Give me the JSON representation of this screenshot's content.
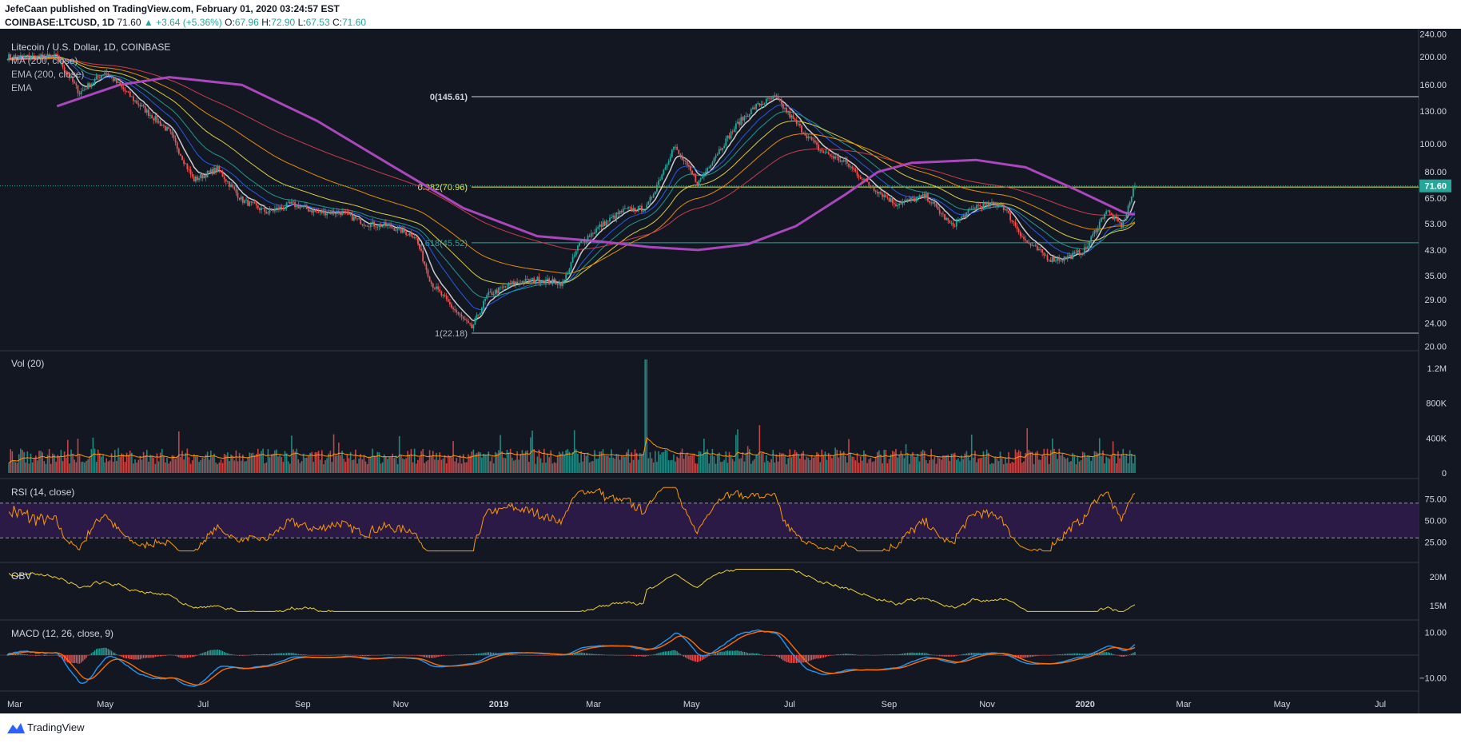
{
  "header": {
    "line1": "JefeCaan published on TradingView.com, February 01, 2020 03:24:57 EST",
    "symbol": "COINBASE:LTCUSD, 1D",
    "last": "71.60",
    "change": "+3.64 (+5.36%)",
    "o_label": "O:",
    "o": "67.96",
    "h_label": "H:",
    "h": "72.90",
    "l_label": "L:",
    "l": "67.53",
    "c_label": "C:",
    "c": "71.60"
  },
  "price_pane": {
    "title": "Litecoin / U.S. Dollar, 1D, COINBASE",
    "indicators": [
      "MA (200, close)",
      "EMA (200, close)",
      "EMA"
    ],
    "current_price_tag": "71.60"
  },
  "volume_pane": {
    "title": "Vol (20)"
  },
  "rsi_pane": {
    "title": "RSI (14, close)"
  },
  "obv_pane": {
    "title": "OBV"
  },
  "macd_pane": {
    "title": "MACD (12, 26, close, 9)"
  },
  "footer": {
    "brand": "TradingView",
    "logo_icon": "tradingview-logo-icon"
  },
  "colors": {
    "background": "#131722",
    "up": "#26a69a",
    "down": "#ef5350",
    "ma200": "#ab47bc",
    "fib_line": "#e0f040",
    "fib_618": "#26a69a",
    "rsi": "#ff9800",
    "obv": "#f0d030",
    "macd": "#2196f3",
    "signal": "#ff6d00"
  },
  "chart_data": [
    {
      "type": "line",
      "title": "Litecoin / U.S. Dollar, 1D, COINBASE",
      "scale": "log",
      "x_axis_labels": [
        "Mar",
        "May",
        "Jul",
        "Sep",
        "Nov",
        "2019",
        "Mar",
        "May",
        "Jul",
        "Sep",
        "Nov",
        "2020",
        "Mar",
        "May",
        "Jul"
      ],
      "y_axis_labels": [
        "240.00",
        "200.00",
        "160.00",
        "130.00",
        "100.00",
        "80.00",
        "65.00",
        "53.00",
        "43.00",
        "35.00",
        "29.00",
        "24.00",
        "20.00"
      ],
      "series": [
        {
          "name": "LTCUSD",
          "x": [
            "2018-04-01",
            "2018-04-15",
            "2018-05-01",
            "2018-05-20",
            "2018-06-10",
            "2018-06-25",
            "2018-07-10",
            "2018-07-25",
            "2018-08-10",
            "2018-08-25",
            "2018-09-10",
            "2018-09-25",
            "2018-10-10",
            "2018-10-25",
            "2018-11-10",
            "2018-11-20",
            "2018-12-01",
            "2018-12-15",
            "2018-12-25",
            "2019-01-10",
            "2019-01-25",
            "2019-02-10",
            "2019-02-20",
            "2019-03-05",
            "2019-03-20",
            "2019-04-03",
            "2019-04-20",
            "2019-05-05",
            "2019-05-15",
            "2019-05-30",
            "2019-06-10",
            "2019-06-22",
            "2019-07-05",
            "2019-07-20",
            "2019-08-05",
            "2019-08-20",
            "2019-09-05",
            "2019-09-24",
            "2019-10-10",
            "2019-10-25",
            "2019-11-10",
            "2019-11-25",
            "2019-12-10",
            "2019-12-18",
            "2020-01-01",
            "2020-01-14",
            "2020-01-24",
            "2020-02-01"
          ],
          "values": [
            200,
            150,
            178,
            140,
            110,
            75,
            82,
            64,
            58,
            62,
            58,
            58,
            53,
            52,
            48,
            33,
            28,
            23,
            30,
            33,
            34,
            33,
            45,
            52,
            59,
            60,
            98,
            73,
            90,
            118,
            135,
            145,
            118,
            95,
            86,
            72,
            62,
            66,
            52,
            61,
            62,
            46,
            40,
            40,
            43,
            59,
            52,
            71.6
          ]
        },
        {
          "name": "MA (200, close)",
          "x": [
            "2018-04-01",
            "2018-05-10",
            "2018-06-10",
            "2018-07-25",
            "2018-09-10",
            "2018-10-25",
            "2018-12-10",
            "2019-01-25",
            "2019-03-05",
            "2019-04-05",
            "2019-05-05",
            "2019-06-05",
            "2019-07-05",
            "2019-08-05",
            "2019-08-25",
            "2019-09-15",
            "2019-10-25",
            "2019-11-25",
            "2019-12-25",
            "2020-01-25",
            "2020-02-01"
          ],
          "values": [
            135,
            160,
            170,
            160,
            120,
            85,
            60,
            48,
            46,
            44,
            43,
            45,
            52,
            67,
            80,
            86,
            88,
            83,
            70,
            58,
            57
          ]
        }
      ],
      "annotations": [
        {
          "label": "0(145.61)",
          "value": 145.61
        },
        {
          "label": "0.382(70.96)",
          "value": 70.96
        },
        {
          "label": "0.618(45.52)",
          "value": 45.52
        },
        {
          "label": "1(22.18)",
          "value": 22.18
        }
      ]
    },
    {
      "type": "bar",
      "title": "Vol (20)",
      "y_axis_labels": [
        "1.2M",
        "800K",
        "400K",
        "0"
      ],
      "peak_volume": "1.3M",
      "peak_date": "2019-04-03"
    },
    {
      "type": "line",
      "title": "RSI (14, close)",
      "y_axis_labels": [
        "75.00",
        "50.00",
        "25.00"
      ],
      "bands": [
        30,
        70
      ]
    },
    {
      "type": "line",
      "title": "OBV",
      "y_axis_labels": [
        "20M",
        "15M"
      ]
    },
    {
      "type": "line",
      "title": "MACD (12, 26, close, 9)",
      "y_axis_labels": [
        "10.00",
        "-10.00"
      ]
    }
  ]
}
